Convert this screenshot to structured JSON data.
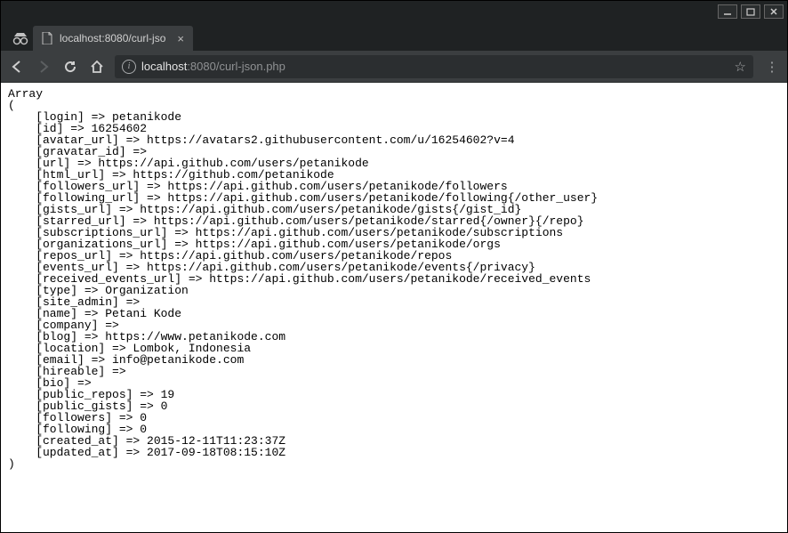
{
  "window": {
    "tab_title": "localhost:8080/curl-jso",
    "url_host": "localhost",
    "url_port_path": ":8080/curl-json.php"
  },
  "array_data": {
    "login": "petanikode",
    "id": "16254602",
    "avatar_url": "https://avatars2.githubusercontent.com/u/16254602?v=4",
    "gravatar_id": "",
    "url": "https://api.github.com/users/petanikode",
    "html_url": "https://github.com/petanikode",
    "followers_url": "https://api.github.com/users/petanikode/followers",
    "following_url": "https://api.github.com/users/petanikode/following{/other_user}",
    "gists_url": "https://api.github.com/users/petanikode/gists{/gist_id}",
    "starred_url": "https://api.github.com/users/petanikode/starred{/owner}{/repo}",
    "subscriptions_url": "https://api.github.com/users/petanikode/subscriptions",
    "organizations_url": "https://api.github.com/users/petanikode/orgs",
    "repos_url": "https://api.github.com/users/petanikode/repos",
    "events_url": "https://api.github.com/users/petanikode/events{/privacy}",
    "received_events_url": "https://api.github.com/users/petanikode/received_events",
    "type": "Organization",
    "site_admin": "",
    "name": "Petani Kode",
    "company": "",
    "blog": "https://www.petanikode.com",
    "location": "Lombok, Indonesia",
    "email": "info@petanikode.com",
    "hireable": "",
    "bio": "",
    "public_repos": "19",
    "public_gists": "0",
    "followers": "0",
    "following": "0",
    "created_at": "2015-12-11T11:23:37Z",
    "updated_at": "2017-09-18T08:15:10Z"
  },
  "array_order": [
    "login",
    "id",
    "avatar_url",
    "gravatar_id",
    "url",
    "html_url",
    "followers_url",
    "following_url",
    "gists_url",
    "starred_url",
    "subscriptions_url",
    "organizations_url",
    "repos_url",
    "events_url",
    "received_events_url",
    "type",
    "site_admin",
    "name",
    "company",
    "blog",
    "location",
    "email",
    "hireable",
    "bio",
    "public_repos",
    "public_gists",
    "followers",
    "following",
    "created_at",
    "updated_at"
  ],
  "labels": {
    "array_open": "Array",
    "paren_open": "(",
    "paren_close": ")"
  }
}
